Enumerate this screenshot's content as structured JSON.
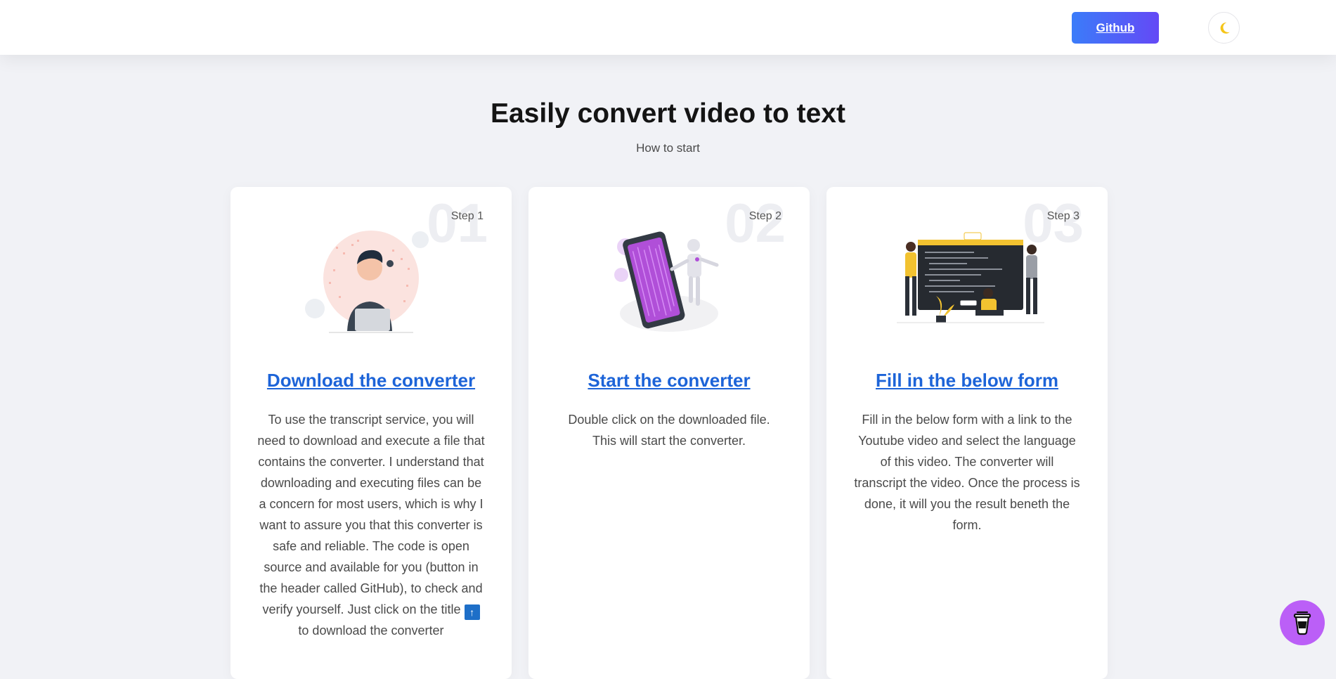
{
  "header": {
    "github_label": "Github",
    "theme_icon": "moon-icon"
  },
  "hero": {
    "title": "Easily convert video to text",
    "subtitle": "How to start"
  },
  "steps": [
    {
      "number": "01",
      "step_label": "Step 1",
      "title": "Download the converter",
      "text_before_icon": "To use the transcript service, you will need to download and execute a file that contains the converter. I understand that downloading and executing files can be a concern for most users, which is why I want to assure you that this converter is safe and reliable. The code is open source and available for you (button in the header called GitHub), to check and verify yourself. Just click on the title",
      "text_after_icon": " to download the converter",
      "illustration": "person-laptop-illustration"
    },
    {
      "number": "02",
      "step_label": "Step 2",
      "title": "Start the converter",
      "text": "Double click on the downloaded file. This will start the converter.",
      "illustration": "robot-phone-illustration"
    },
    {
      "number": "03",
      "step_label": "Step 3",
      "title": "Fill in the below form",
      "text": "Fill in the below form with a link to the Youtube video and select the language of this video. The converter will transcript the video. Once the process is done, it will you the result beneth the form.",
      "illustration": "team-coding-illustration"
    }
  ],
  "floating": {
    "coffee_icon": "coffee-cup-icon"
  },
  "colors": {
    "accent_link": "#1d64d8",
    "github_gradient_start": "#3b7cf9",
    "github_gradient_end": "#6449f6",
    "coffee_button": "#bb5ff7",
    "moon": "#f5c518"
  }
}
